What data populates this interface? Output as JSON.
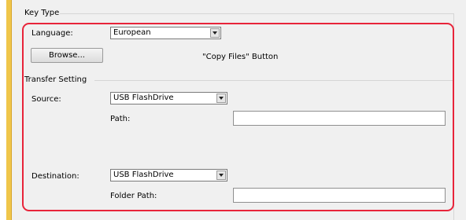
{
  "key_type": {
    "group_label": "Key Type",
    "language_label": "Language:",
    "language_value": "European",
    "browse_button": "Browse...",
    "copy_files_text": "\"Copy Files\" Button"
  },
  "transfer_setting": {
    "group_label": "Transfer Setting",
    "source_label": "Source:",
    "source_value": "USB FlashDrive",
    "path_label": "Path:",
    "path_value": "",
    "destination_label": "Destination:",
    "destination_value": "USB FlashDrive",
    "folder_path_label": "Folder Path:",
    "folder_path_value": ""
  },
  "colors": {
    "highlight": "#e8243a",
    "stripe": "#f0c64a"
  },
  "icons": {
    "combo_dropdown": "chevron-down-icon"
  }
}
